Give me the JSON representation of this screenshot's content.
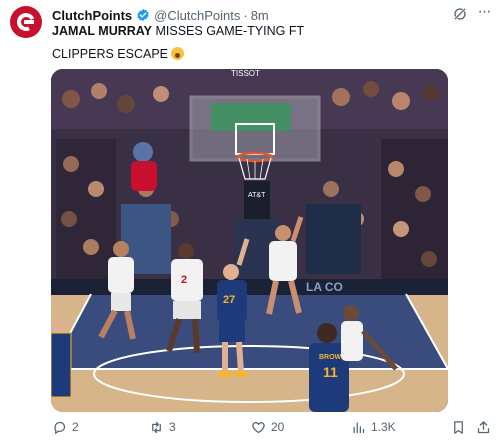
{
  "tweet": {
    "author": {
      "display_name": "ClutchPoints",
      "handle": "@ClutchPoints",
      "separator": "·",
      "time": "8m",
      "verified": true,
      "avatar_icon": "clutchpoints-logo"
    },
    "text": {
      "headline_bold": "JAMAL MURRAY",
      "headline_rest": " MISSES GAME-TYING FT",
      "line2": "CLIPPERS ESCAPE",
      "line2_emoji": "astonished-face-emoji"
    },
    "media": {
      "description_icon": "basketball-game-photo",
      "arena_text": "TISSOT",
      "court_text": "LA CO",
      "jersey_numbers": [
        "2",
        "27",
        "11"
      ],
      "jersey_names": [
        "BROWN"
      ],
      "colors": {
        "crowd": "#3a3046",
        "court": "#d7b58a",
        "nuggets_navy": "#1d3a7a",
        "nuggets_gold": "#f6b52c",
        "clippers_white": "#f2f2f2"
      }
    },
    "actions": {
      "reply_count": "2",
      "retweet_count": "3",
      "like_count": "20",
      "views_count": "1.3K"
    },
    "colors": {
      "text": "#0f1419",
      "secondary": "#536471",
      "verified": "#1d9bf0",
      "brand": "#c8102e"
    }
  }
}
